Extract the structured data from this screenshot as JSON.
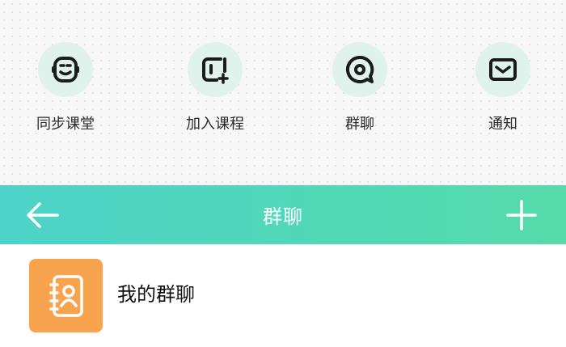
{
  "colors": {
    "icon_circle_bg": "#dff3ec",
    "icon_stroke": "#1b1b1b",
    "header_gradient_start": "#4dd3c9",
    "header_gradient_end": "#55dba9",
    "group_icon_bg": "#f8a34d"
  },
  "features": [
    {
      "label": "同步课堂",
      "icon": "robot-face-icon"
    },
    {
      "label": "加入课程",
      "icon": "add-course-icon"
    },
    {
      "label": "群聊",
      "icon": "chat-bubble-icon"
    },
    {
      "label": "通知",
      "icon": "envelope-icon"
    }
  ],
  "header": {
    "title": "群聊",
    "back_icon": "arrow-left-icon",
    "add_icon": "plus-icon"
  },
  "groups": [
    {
      "label": "我的群聊",
      "icon": "contact-book-icon"
    }
  ]
}
